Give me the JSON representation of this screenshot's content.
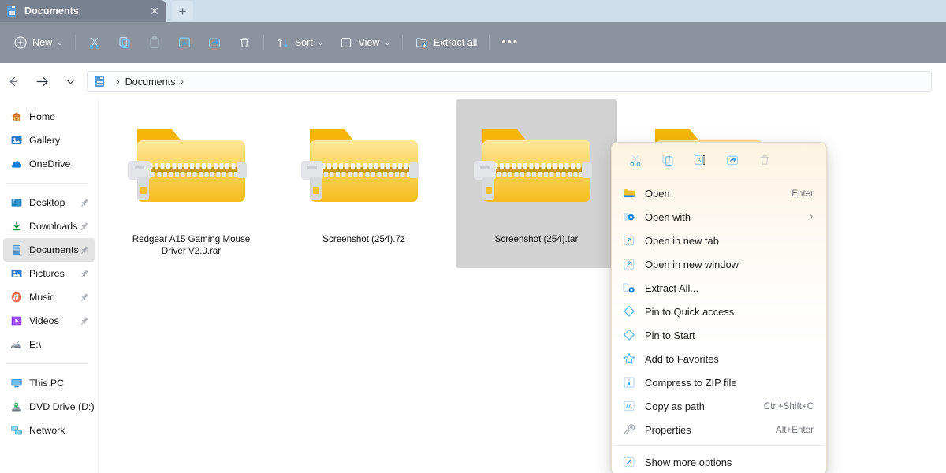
{
  "window": {
    "tab": {
      "title": "Documents",
      "icon": "documents-folder-icon",
      "close_label": "✕"
    },
    "new_tab_label": "+"
  },
  "toolbar": {
    "new_label": "New",
    "new_caret": "⌄",
    "cut_label": "Cut",
    "copy_label": "Copy",
    "paste_label": "Paste",
    "rename_label": "Rename",
    "share_label": "Share",
    "delete_label": "Delete",
    "sort_label": "Sort",
    "sort_caret": "⌄",
    "view_label": "View",
    "view_caret": "⌄",
    "extract_all_label": "Extract all",
    "more_label": "•••"
  },
  "address": {
    "back_label": "←",
    "forward_label": "→",
    "recent_label": "⌄",
    "up_label": "↑",
    "crumbs": [
      "Documents"
    ],
    "separator": "›",
    "trailing_separator": "›"
  },
  "sidebar": {
    "groups": [
      {
        "items": [
          {
            "label": "Home",
            "icon": "home-icon",
            "pinned": false,
            "selected": false
          },
          {
            "label": "Gallery",
            "icon": "gallery-icon",
            "pinned": false,
            "selected": false
          },
          {
            "label": "OneDrive",
            "icon": "onedrive-cloud-icon",
            "pinned": false,
            "selected": false
          }
        ]
      },
      {
        "items": [
          {
            "label": "Desktop",
            "icon": "desktop-icon",
            "pinned": true,
            "selected": false
          },
          {
            "label": "Downloads",
            "icon": "downloads-icon",
            "pinned": true,
            "selected": false
          },
          {
            "label": "Documents",
            "icon": "documents-icon",
            "pinned": true,
            "selected": true
          },
          {
            "label": "Pictures",
            "icon": "pictures-icon",
            "pinned": true,
            "selected": false
          },
          {
            "label": "Music",
            "icon": "music-icon",
            "pinned": true,
            "selected": false
          },
          {
            "label": "Videos",
            "icon": "videos-icon",
            "pinned": true,
            "selected": false
          },
          {
            "label": "E:\\",
            "icon": "drive-icon",
            "pinned": false,
            "selected": false
          }
        ]
      },
      {
        "items": [
          {
            "label": "This PC",
            "icon": "this-pc-icon",
            "pinned": false,
            "selected": false
          },
          {
            "label": "DVD Drive (D:) CCC",
            "icon": "dvd-drive-icon",
            "pinned": false,
            "selected": false
          },
          {
            "label": "Network",
            "icon": "network-icon",
            "pinned": false,
            "selected": false
          }
        ]
      }
    ]
  },
  "files": [
    {
      "name": "Redgear A15 Gaming Mouse Driver V2.0.rar",
      "icon": "zip-folder-icon",
      "selected": false
    },
    {
      "name": "Screenshot (254).7z",
      "icon": "zip-folder-icon",
      "selected": false
    },
    {
      "name": "Screenshot (254).tar",
      "icon": "zip-folder-icon",
      "selected": true
    },
    {
      "name": "",
      "icon": "zip-folder-icon",
      "selected": false
    }
  ],
  "context_menu": {
    "header_actions": [
      {
        "name": "cut",
        "icon": "scissors-icon",
        "disabled": false
      },
      {
        "name": "copy",
        "icon": "copy-icon",
        "disabled": false
      },
      {
        "name": "rename",
        "icon": "rename-icon",
        "disabled": false
      },
      {
        "name": "share",
        "icon": "share-icon",
        "disabled": false
      },
      {
        "name": "delete",
        "icon": "trash-icon",
        "disabled": true
      }
    ],
    "items": [
      {
        "label": "Open",
        "icon": "folder-open-icon",
        "accel": "Enter",
        "submenu": false
      },
      {
        "label": "Open with",
        "icon": "open-with-icon",
        "accel": "",
        "submenu": true
      },
      {
        "label": "Open in new tab",
        "icon": "new-tab-icon",
        "accel": "",
        "submenu": false
      },
      {
        "label": "Open in new window",
        "icon": "new-window-icon",
        "accel": "",
        "submenu": false
      },
      {
        "label": "Extract All...",
        "icon": "extract-all-icon",
        "accel": "",
        "submenu": false
      },
      {
        "label": "Pin to Quick access",
        "icon": "pin-icon",
        "accel": "",
        "submenu": false
      },
      {
        "label": "Pin to Start",
        "icon": "pin-icon",
        "accel": "",
        "submenu": false
      },
      {
        "label": "Add to Favorites",
        "icon": "star-icon",
        "accel": "",
        "submenu": false
      },
      {
        "label": "Compress to ZIP file",
        "icon": "compress-icon",
        "accel": "",
        "submenu": false
      },
      {
        "label": "Copy as path",
        "icon": "copy-path-icon",
        "accel": "Ctrl+Shift+C",
        "submenu": false
      },
      {
        "label": "Properties",
        "icon": "wrench-icon",
        "accel": "Alt+Enter",
        "submenu": false
      }
    ],
    "more_options": {
      "label": "Show more options",
      "icon": "show-more-icon"
    }
  },
  "colors": {
    "tabstrip": "#cfdeeb",
    "tab_active": "#77818f",
    "toolbar": "#8b949e",
    "selection": "#d2d2d2",
    "menu_tint": "#fdf3e0",
    "accent_blue": "#0f6cbd",
    "folder_yellow": "#f7c325"
  }
}
